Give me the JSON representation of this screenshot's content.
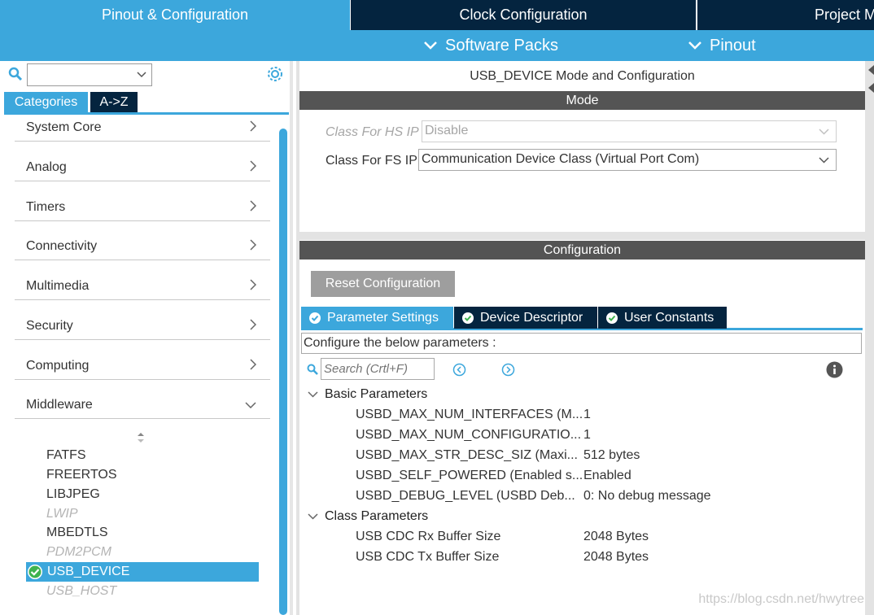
{
  "tabs": {
    "pinout": "Pinout & Configuration",
    "clock": "Clock Configuration",
    "project": "Project M"
  },
  "subbar": {
    "software_packs": "Software Packs",
    "pinout": "Pinout"
  },
  "left": {
    "search_value": "",
    "tabs": {
      "categories": "Categories",
      "az": "A->Z"
    },
    "categories": [
      "System Core",
      "Analog",
      "Timers",
      "Connectivity",
      "Multimedia",
      "Security",
      "Computing",
      "Middleware"
    ],
    "middleware": {
      "fatfs": "FATFS",
      "freertos": "FREERTOS",
      "libjpeg": "LIBJPEG",
      "lwip": "LWIP",
      "mbedtls": "MBEDTLS",
      "pdm2pcm": "PDM2PCM",
      "usb_device": "USB_DEVICE",
      "usb_host": "USB_HOST"
    }
  },
  "mode": {
    "title": "USB_DEVICE Mode and Configuration",
    "section": "Mode",
    "hs_label": "Class For HS IP",
    "hs_value": "Disable",
    "fs_label": "Class For FS IP",
    "fs_value": "Communication Device Class (Virtual Port Com)"
  },
  "config": {
    "section": "Configuration",
    "reset_label": "Reset Configuration",
    "tabs": {
      "params": "Parameter Settings",
      "device": "Device Descriptor",
      "user": "User Constants"
    },
    "description": "Configure the below parameters :",
    "search_placeholder": "Search (Crtl+F)",
    "basic_group": "Basic Parameters",
    "basic": [
      {
        "name": "USBD_MAX_NUM_INTERFACES (M...",
        "value": "1"
      },
      {
        "name": "USBD_MAX_NUM_CONFIGURATIO...",
        "value": "1"
      },
      {
        "name": "USBD_MAX_STR_DESC_SIZ (Maxi...",
        "value": "512 bytes"
      },
      {
        "name": "USBD_SELF_POWERED (Enabled s...",
        "value": "Enabled"
      },
      {
        "name": "USBD_DEBUG_LEVEL (USBD Deb...",
        "value": "0: No debug message"
      }
    ],
    "class_group": "Class Parameters",
    "class": [
      {
        "name": "USB CDC Rx Buffer Size",
        "value": "2048 Bytes"
      },
      {
        "name": "USB CDC Tx Buffer Size",
        "value": "2048 Bytes"
      }
    ]
  },
  "watermark": "https://blog.csdn.net/hwytree",
  "colors": {
    "accent": "#3ca7dc",
    "dark": "#04243f",
    "section": "#545454"
  }
}
